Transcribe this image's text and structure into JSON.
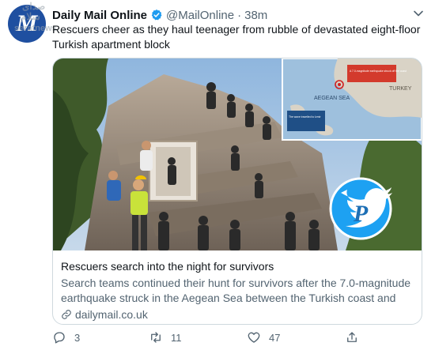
{
  "tweet": {
    "display_name": "Daily Mail Online",
    "handle": "@MailOnline",
    "separator": "·",
    "timestamp": "38m",
    "text": "Rescuers cheer as they haul teenager from rubble of devastated eight-floor Turkish apartment block"
  },
  "avatar": {
    "icon": "daily-mail-logo-icon",
    "glyph": "M"
  },
  "watermark": {
    "line1": "صدای",
    "line2": "سلام",
    "site": "seratnews"
  },
  "card": {
    "image": {
      "map": {
        "sea_label": "AEGEAN SEA",
        "country_label": "TURKEY",
        "callout_text": "A 7.0-magnitude earthquake struck off the coast",
        "inset_text": "The wave travelled to Izmir"
      },
      "logo_letter": "P"
    },
    "title": "Rescuers search into the night for survivors",
    "description": "Search teams continued their hunt for survivors after the 7.0-magnitude earthquake struck in the Aegean Sea between the Turkish coast and the…",
    "domain": "dailymail.co.uk"
  },
  "actions": {
    "reply_count": "3",
    "retweet_count": "11",
    "like_count": "47"
  },
  "colors": {
    "verified": "#1d9bf0",
    "muted_text": "#536471",
    "twitter_blue": "#1da1f2"
  }
}
